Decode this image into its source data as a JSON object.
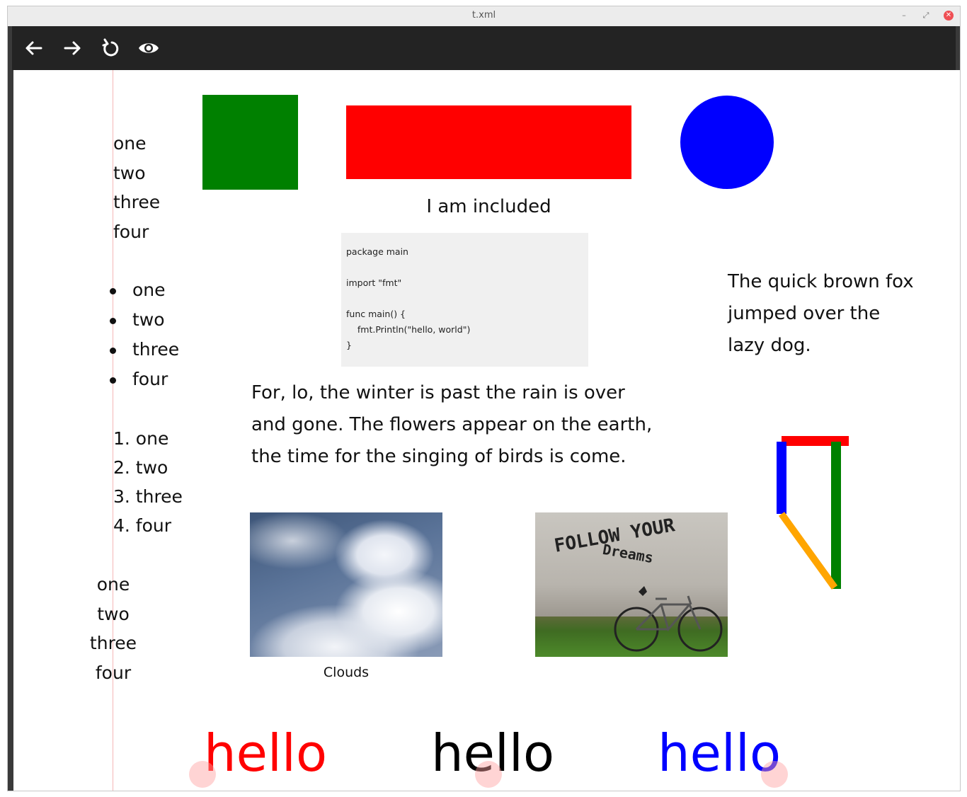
{
  "window": {
    "title": "t.xml",
    "controls": {
      "minimize": "–",
      "maximize": "⤢",
      "close": "✕"
    }
  },
  "toolbar": {
    "buttons": [
      {
        "name": "back",
        "icon": "arrow-left-icon"
      },
      {
        "name": "forward",
        "icon": "arrow-right-icon"
      },
      {
        "name": "reload",
        "icon": "reload-icon"
      },
      {
        "name": "preview",
        "icon": "eye-icon"
      }
    ]
  },
  "content": {
    "plain_list": [
      "one",
      "two",
      "three",
      "four"
    ],
    "bullet_list": [
      "one",
      "two",
      "three",
      "four"
    ],
    "ordered_list": [
      "1. one",
      "2. two",
      "3. three",
      "4. four"
    ],
    "centered_list": [
      "one",
      "two",
      "three",
      "four"
    ],
    "shapes": {
      "square_color": "#008000",
      "rect_color": "#ff0000",
      "circle_color": "#0000ff"
    },
    "included_text": "I am included",
    "code_lines": [
      "package main",
      "",
      "import \"fmt\"",
      "",
      "func main() {",
      "    fmt.Println(\"hello, world\")",
      "}"
    ],
    "verse_lines": [
      "For, lo, the winter is past the rain is over",
      "and gone. The flowers appear on the earth,",
      "the time for the singing of birds is come."
    ],
    "fox_lines": [
      "The quick brown fox",
      "jumped over the",
      "lazy dog."
    ],
    "images": {
      "clouds_caption": "Clouds",
      "wall_graffiti_line1": "FOLLOW YOUR",
      "wall_graffiti_line2": "Dreams"
    },
    "lines_shape_colors": [
      "#ff0000",
      "#008000",
      "#0000ff",
      "#ffa500"
    ],
    "hello_words": [
      {
        "text": "hello",
        "color": "#ff0000"
      },
      {
        "text": "hello",
        "color": "#000000"
      },
      {
        "text": "hello",
        "color": "#0000ff"
      }
    ]
  }
}
